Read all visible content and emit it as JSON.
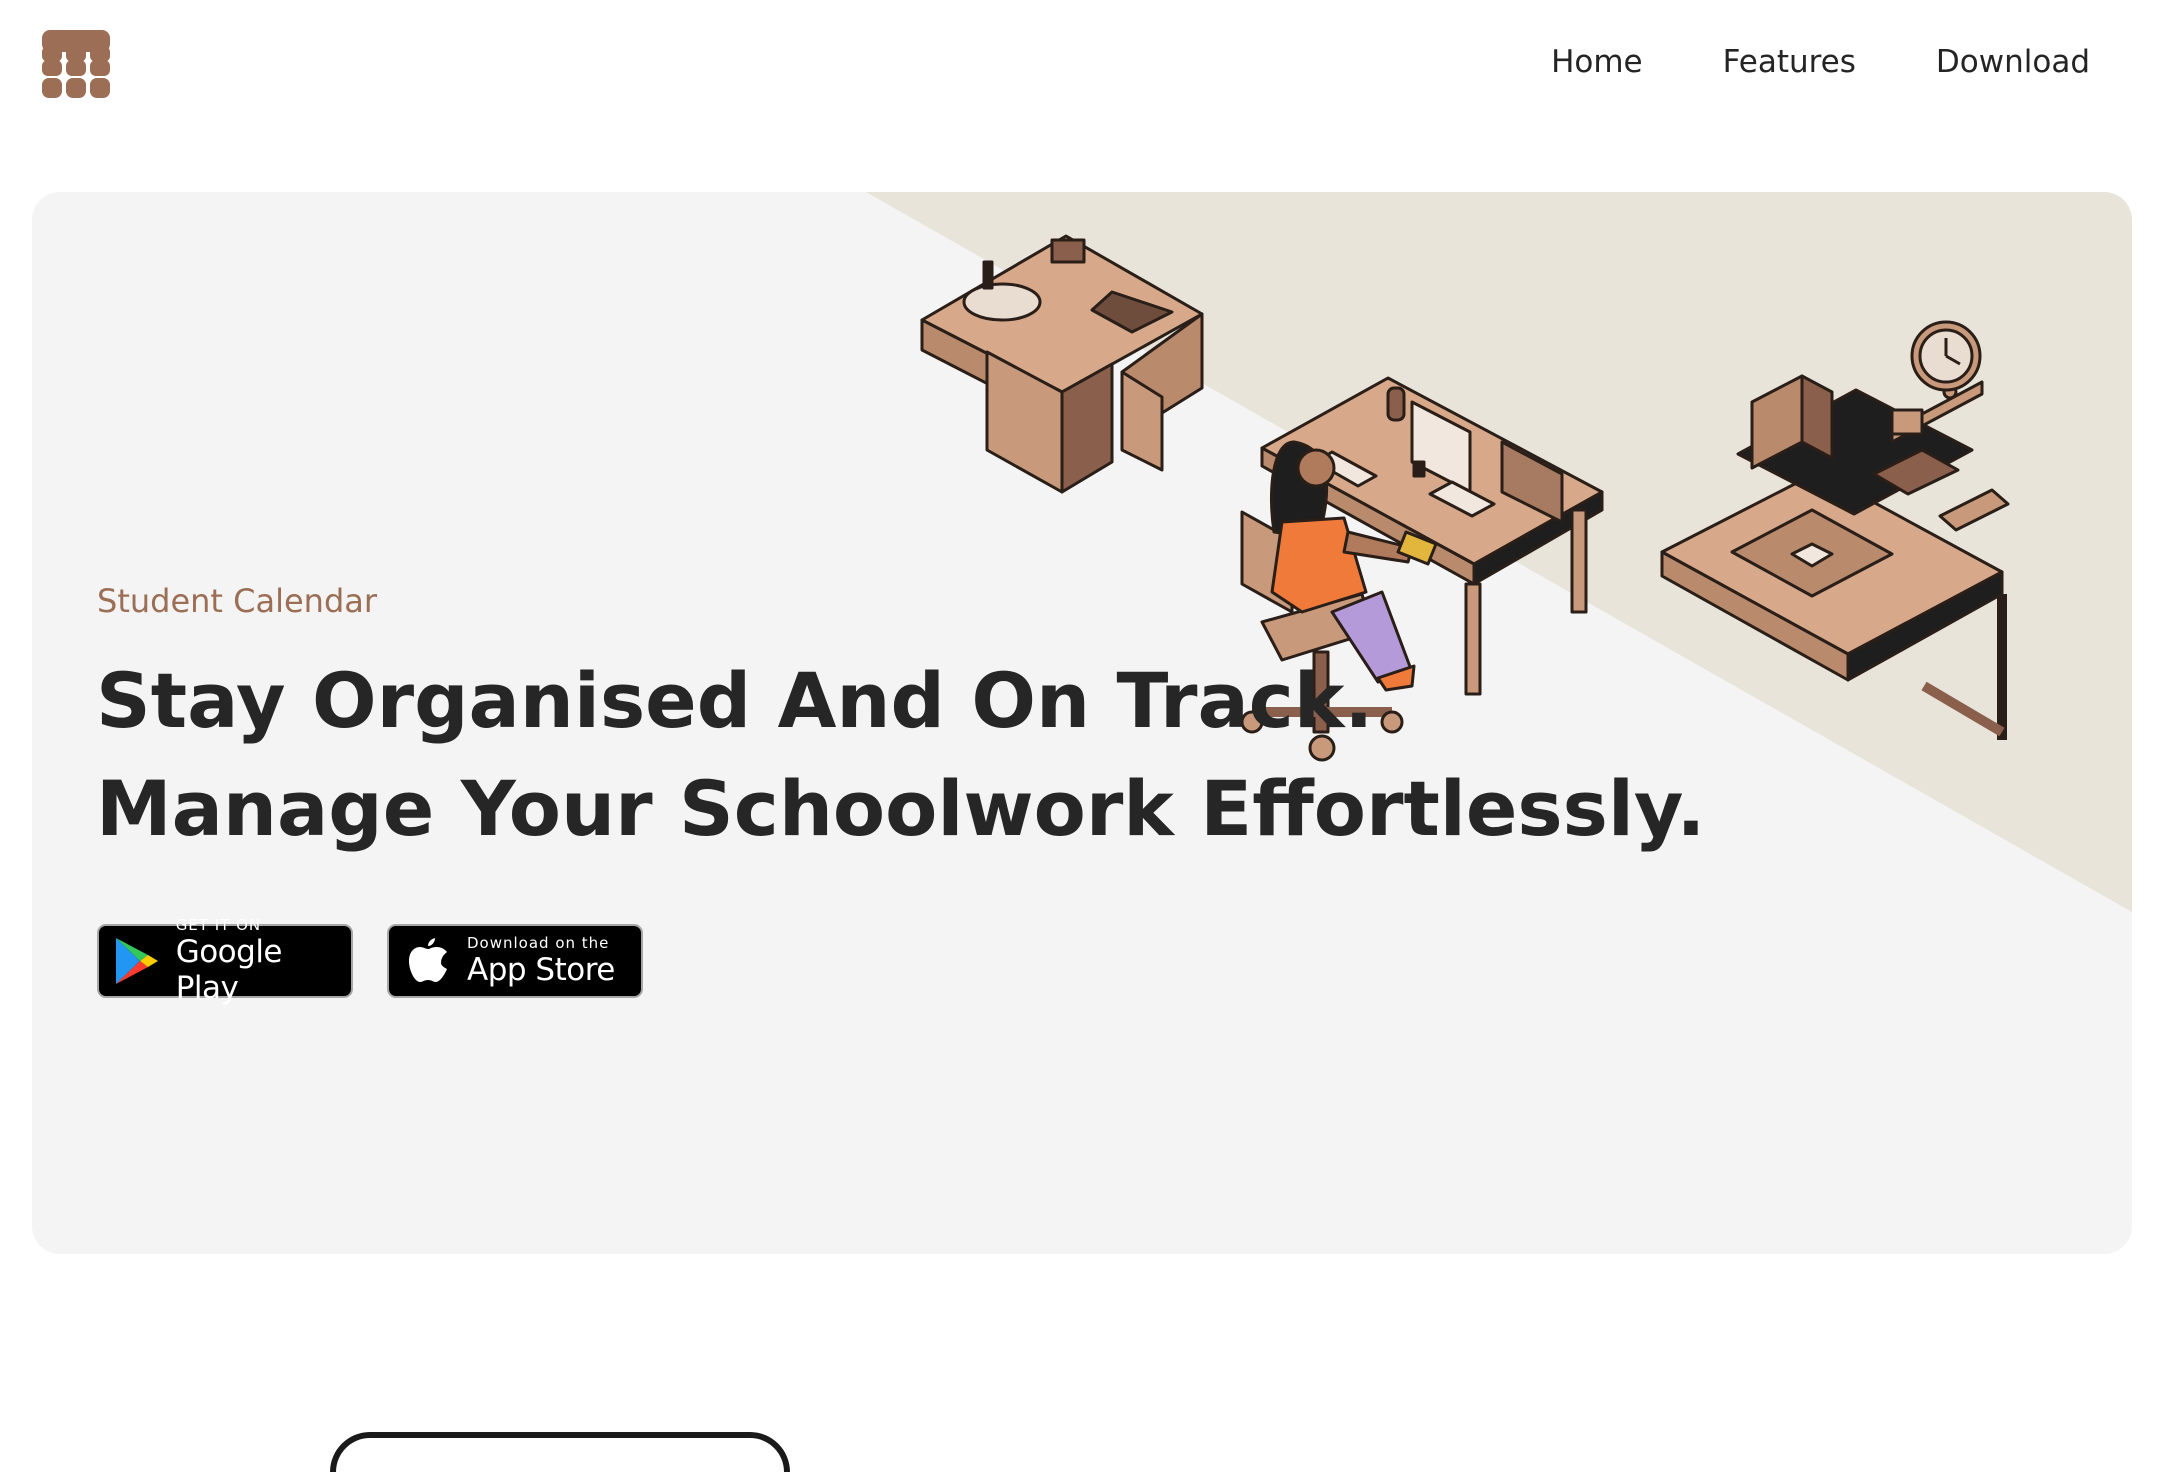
{
  "nav": {
    "logo_icon": "calendar-grid-icon",
    "links": [
      "Home",
      "Features",
      "Download"
    ]
  },
  "hero": {
    "eyebrow": "Student Calendar",
    "headline_line1": "Stay Organised And On Track.",
    "headline_line2": "Manage Your Schoolwork Effortlessly.",
    "illustration": "isometric-student-desk-illustration"
  },
  "badges": {
    "google": {
      "small": "GET IT ON",
      "big": "Google Play",
      "icon": "google-play-icon"
    },
    "apple": {
      "small": "Download on the",
      "big": "App Store",
      "icon": "apple-icon"
    }
  },
  "colors": {
    "accent": "#9b6e55",
    "hero_bg": "#f4f4f4",
    "diagonal_band": "#e8e4da",
    "wood": "#c89a7b",
    "wood_dark": "#8a5f4c"
  }
}
